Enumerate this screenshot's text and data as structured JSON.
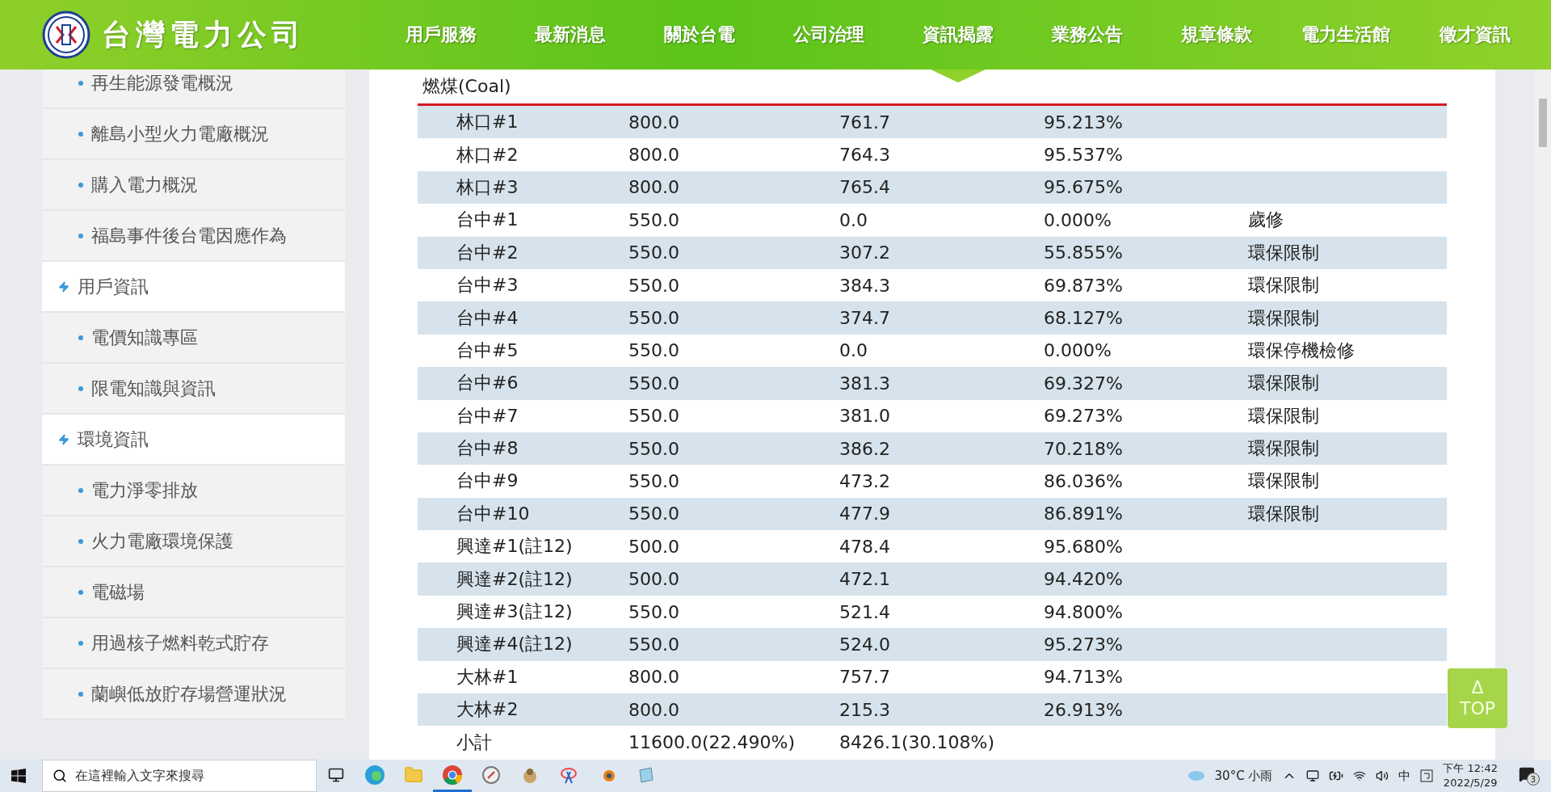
{
  "header": {
    "logo_text": "台灣電力公司",
    "nav": [
      {
        "label": "用戶服務",
        "selected": false
      },
      {
        "label": "最新消息",
        "selected": false
      },
      {
        "label": "關於台電",
        "selected": false
      },
      {
        "label": "公司治理",
        "selected": false
      },
      {
        "label": "資訊揭露",
        "selected": true
      },
      {
        "label": "業務公告",
        "selected": false
      },
      {
        "label": "規章條款",
        "selected": false
      },
      {
        "label": "電力生活館",
        "selected": false
      },
      {
        "label": "徵才資訊",
        "selected": false
      }
    ]
  },
  "sidebar": {
    "items": [
      {
        "kind": "sub",
        "label": "再生能源發電概況"
      },
      {
        "kind": "sub",
        "label": "離島小型火力電廠概況"
      },
      {
        "kind": "sub",
        "label": "購入電力概況"
      },
      {
        "kind": "sub",
        "label": "福島事件後台電因應作為"
      },
      {
        "kind": "section",
        "label": "用戶資訊"
      },
      {
        "kind": "sub",
        "label": "電價知識專區"
      },
      {
        "kind": "sub",
        "label": "限電知識與資訊"
      },
      {
        "kind": "section",
        "label": "環境資訊"
      },
      {
        "kind": "sub",
        "label": "電力淨零排放"
      },
      {
        "kind": "sub",
        "label": "火力電廠環境保護"
      },
      {
        "kind": "sub",
        "label": "電磁場"
      },
      {
        "kind": "sub",
        "label": "用過核子燃料乾式貯存"
      },
      {
        "kind": "sub",
        "label": "蘭嶼低放貯存場營運狀況"
      }
    ]
  },
  "table": {
    "title": "燃煤(Coal)",
    "rows": [
      {
        "cells": [
          "林口#1",
          "800.0",
          "761.7",
          "95.213%",
          ""
        ]
      },
      {
        "cells": [
          "林口#2",
          "800.0",
          "764.3",
          "95.537%",
          ""
        ]
      },
      {
        "cells": [
          "林口#3",
          "800.0",
          "765.4",
          "95.675%",
          ""
        ]
      },
      {
        "cells": [
          "台中#1",
          "550.0",
          "0.0",
          "0.000%",
          "歲修"
        ]
      },
      {
        "cells": [
          "台中#2",
          "550.0",
          "307.2",
          "55.855%",
          "環保限制"
        ]
      },
      {
        "cells": [
          "台中#3",
          "550.0",
          "384.3",
          "69.873%",
          "環保限制"
        ]
      },
      {
        "cells": [
          "台中#4",
          "550.0",
          "374.7",
          "68.127%",
          "環保限制"
        ]
      },
      {
        "cells": [
          "台中#5",
          "550.0",
          "0.0",
          "0.000%",
          "環保停機檢修"
        ]
      },
      {
        "cells": [
          "台中#6",
          "550.0",
          "381.3",
          "69.327%",
          "環保限制"
        ]
      },
      {
        "cells": [
          "台中#7",
          "550.0",
          "381.0",
          "69.273%",
          "環保限制"
        ]
      },
      {
        "cells": [
          "台中#8",
          "550.0",
          "386.2",
          "70.218%",
          "環保限制"
        ]
      },
      {
        "cells": [
          "台中#9",
          "550.0",
          "473.2",
          "86.036%",
          "環保限制"
        ]
      },
      {
        "cells": [
          "台中#10",
          "550.0",
          "477.9",
          "86.891%",
          "環保限制"
        ]
      },
      {
        "cells": [
          "興達#1(註12)",
          "500.0",
          "478.4",
          "95.680%",
          ""
        ]
      },
      {
        "cells": [
          "興達#2(註12)",
          "500.0",
          "472.1",
          "94.420%",
          ""
        ]
      },
      {
        "cells": [
          "興達#3(註12)",
          "550.0",
          "521.4",
          "94.800%",
          ""
        ]
      },
      {
        "cells": [
          "興達#4(註12)",
          "550.0",
          "524.0",
          "95.273%",
          ""
        ]
      },
      {
        "cells": [
          "大林#1",
          "800.0",
          "757.7",
          "94.713%",
          ""
        ]
      },
      {
        "cells": [
          "大林#2",
          "800.0",
          "215.3",
          "26.913%",
          ""
        ]
      },
      {
        "cells": [
          "小計",
          "11600.0(22.490%)",
          "8426.1(30.108%)",
          "",
          ""
        ]
      }
    ]
  },
  "top_button": {
    "arrow": "Δ",
    "label": "TOP"
  },
  "taskbar": {
    "search_placeholder": "在這裡輸入文字來搜尋",
    "weather": "30°C 小雨",
    "ime": "中",
    "time": "下午 12:42",
    "date": "2022/5/29",
    "notifications": "3"
  }
}
